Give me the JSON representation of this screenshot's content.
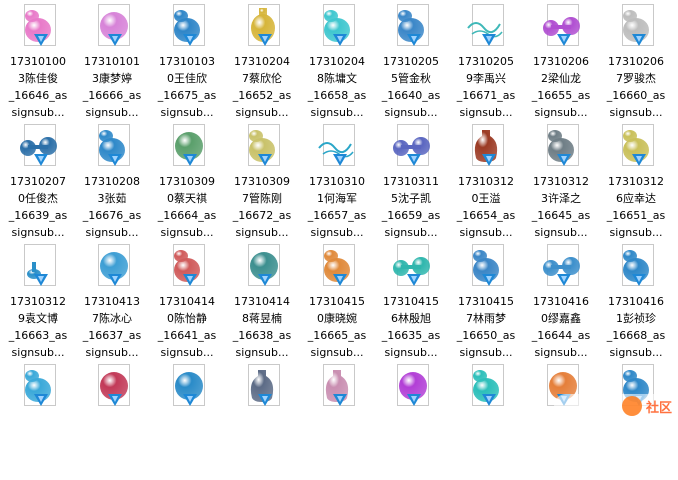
{
  "files": [
    {
      "line1": "17310100",
      "line2": "3陈佳俊",
      "line3": "_16646_as",
      "line4": "signsub...",
      "color": "#e87ac9",
      "shape": "flask"
    },
    {
      "line1": "17310101",
      "line2": "3康梦婷",
      "line3": "_16666_as",
      "line4": "signsub...",
      "color": "#d783d8",
      "shape": "sphere"
    },
    {
      "line1": "17310103",
      "line2": "0王佳欣",
      "line3": "_16675_as",
      "line4": "signsub...",
      "color": "#2f86c8",
      "shape": "flask"
    },
    {
      "line1": "17310204",
      "line2": "7蔡欣伦",
      "line3": "_16652_as",
      "line4": "signsub...",
      "color": "#d6b53a",
      "shape": "bottle"
    },
    {
      "line1": "17310204",
      "line2": "8陈墉文",
      "line3": "_16658_as",
      "line4": "signsub...",
      "color": "#3fc7cf",
      "shape": "flask"
    },
    {
      "line1": "17310205",
      "line2": "5管金秋",
      "line3": "_16640_as",
      "line4": "signsub...",
      "color": "#3b87c8",
      "shape": "flask"
    },
    {
      "line1": "17310205",
      "line2": "9李禹兴",
      "line3": "_16671_as",
      "line4": "signsub...",
      "color": "#3fb8b8",
      "shape": "wave"
    },
    {
      "line1": "17310206",
      "line2": "2梁仙龙",
      "line3": "_16655_as",
      "line4": "signsub...",
      "color": "#b04fd1",
      "shape": "dumbbell"
    },
    {
      "line1": "17310206",
      "line2": "7罗骏杰",
      "line3": "_16660_as",
      "line4": "signsub...",
      "color": "#bdbdbd",
      "shape": "flask"
    },
    {
      "line1": "17310207",
      "line2": "0任俊杰",
      "line3": "_16639_as",
      "line4": "signsub...",
      "color": "#2b6fa8",
      "shape": "dumbbell"
    },
    {
      "line1": "17310208",
      "line2": "3张茹",
      "line3": "_16676_as",
      "line4": "signsub...",
      "color": "#2f89c9",
      "shape": "flask"
    },
    {
      "line1": "17310309",
      "line2": "0蔡天祺",
      "line3": "_16664_as",
      "line4": "signsub...",
      "color": "#5a9f6b",
      "shape": "sphere"
    },
    {
      "line1": "17310309",
      "line2": "7管陈刚",
      "line3": "_16672_as",
      "line4": "signsub...",
      "color": "#c9c26a",
      "shape": "flask"
    },
    {
      "line1": "17310310",
      "line2": "1何海军",
      "line3": "_16657_as",
      "line4": "signsub...",
      "color": "#2aa6c8",
      "shape": "wave"
    },
    {
      "line1": "17310311",
      "line2": "5沈子凯",
      "line3": "_16659_as",
      "line4": "signsub...",
      "color": "#5a66c0",
      "shape": "dumbbell"
    },
    {
      "line1": "17310312",
      "line2": "0王溢",
      "line3": "_16654_as",
      "line4": "signsub...",
      "color": "#9b3a24",
      "shape": "vase"
    },
    {
      "line1": "17310312",
      "line2": "3许泽之",
      "line3": "_16645_as",
      "line4": "signsub...",
      "color": "#6f7e86",
      "shape": "flask"
    },
    {
      "line1": "17310312",
      "line2": "6应幸达",
      "line3": "_16651_as",
      "line4": "signsub...",
      "color": "#c9c05a",
      "shape": "flask"
    },
    {
      "line1": "17310312",
      "line2": "9袁文博",
      "line3": "_16663_as",
      "line4": "signsub...",
      "color": "#2a8fc8",
      "shape": "small"
    },
    {
      "line1": "17310413",
      "line2": "7陈冰心",
      "line3": "_16637_as",
      "line4": "signsub...",
      "color": "#3d9ed4",
      "shape": "sphere"
    },
    {
      "line1": "17310414",
      "line2": "0陈怡静",
      "line3": "_16641_as",
      "line4": "signsub...",
      "color": "#d05b5b",
      "shape": "flask"
    },
    {
      "line1": "17310414",
      "line2": "8蒋昱楠",
      "line3": "_16638_as",
      "line4": "signsub...",
      "color": "#3c8f8f",
      "shape": "sphere"
    },
    {
      "line1": "17310415",
      "line2": "0康晓婉",
      "line3": "_16665_as",
      "line4": "signsub...",
      "color": "#e08a3b",
      "shape": "flask"
    },
    {
      "line1": "17310415",
      "line2": "6林殷旭",
      "line3": "_16635_as",
      "line4": "signsub...",
      "color": "#2fb6ad",
      "shape": "dumbbell"
    },
    {
      "line1": "17310415",
      "line2": "7林雨梦",
      "line3": "_16650_as",
      "line4": "signsub...",
      "color": "#3b86c6",
      "shape": "flask"
    },
    {
      "line1": "17310416",
      "line2": "0缪嘉鑫",
      "line3": "_16644_as",
      "line4": "signsub...",
      "color": "#3c8fcb",
      "shape": "dumbbell"
    },
    {
      "line1": "17310416",
      "line2": "1彭祯珍",
      "line3": "_16668_as",
      "line4": "signsub...",
      "color": "#2f88c8",
      "shape": "flask"
    },
    {
      "line1": "",
      "line2": "",
      "line3": "",
      "line4": "",
      "color": "#3ba9d9",
      "shape": "flask"
    },
    {
      "line1": "",
      "line2": "",
      "line3": "",
      "line4": "",
      "color": "#c23a58",
      "shape": "sphere"
    },
    {
      "line1": "",
      "line2": "",
      "line3": "",
      "line4": "",
      "color": "#2a8bc8",
      "shape": "sphere"
    },
    {
      "line1": "",
      "line2": "",
      "line3": "",
      "line4": "",
      "color": "#5c6b86",
      "shape": "vase"
    },
    {
      "line1": "",
      "line2": "",
      "line3": "",
      "line4": "",
      "color": "#c98eb1",
      "shape": "vase"
    },
    {
      "line1": "",
      "line2": "",
      "line3": "",
      "line4": "",
      "color": "#b23fd6",
      "shape": "sphere"
    },
    {
      "line1": "",
      "line2": "",
      "line3": "",
      "line4": "",
      "color": "#2cbfba",
      "shape": "flask"
    },
    {
      "line1": "",
      "line2": "",
      "line3": "",
      "line4": "",
      "color": "#e57f3a",
      "shape": "sphere"
    },
    {
      "line1": "",
      "line2": "",
      "line3": "",
      "line4": "",
      "color": "#2f88c8",
      "shape": "flask"
    }
  ],
  "watermark": {
    "text": "社区"
  }
}
